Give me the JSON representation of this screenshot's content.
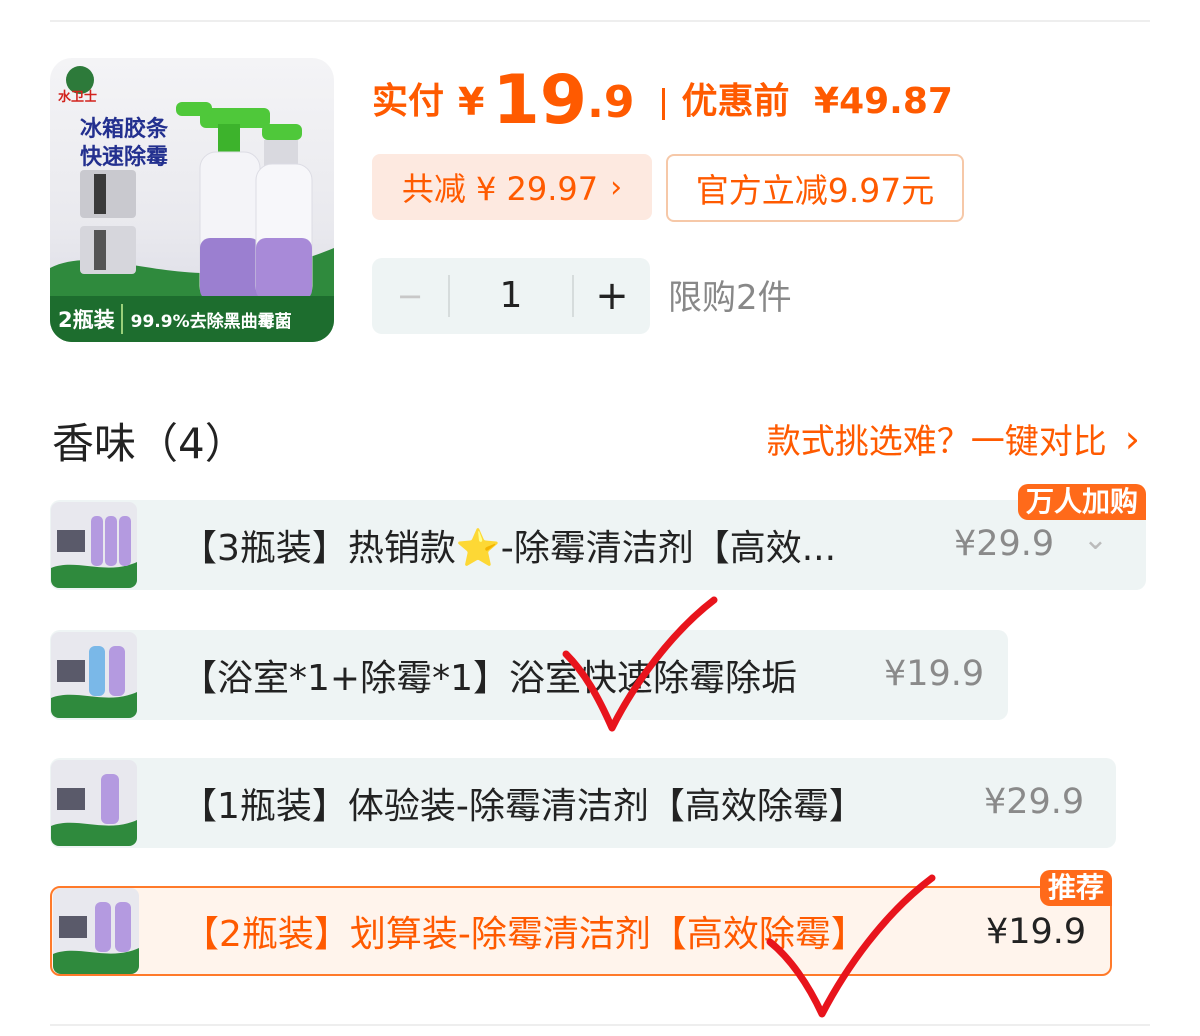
{
  "product": {
    "image_brand": "水卫士",
    "image_title_line1": "冰箱胶条",
    "image_title_line2": "快速除霉",
    "image_banner_left": "2瓶装",
    "image_banner_right": "99.9%去除黑曲霉菌"
  },
  "price": {
    "paid_label": "实付",
    "currency": "¥",
    "paid_int": "19",
    "paid_dec": ".9",
    "original_label": "优惠前",
    "original_value": "¥49.87"
  },
  "discounts": {
    "total_saved": "共减 ¥ 29.97",
    "total_saved_chevron": "›",
    "official": "官方立减9.97元"
  },
  "quantity": {
    "minus": "−",
    "value": "1",
    "plus": "+",
    "limit": "限购2件"
  },
  "variants": {
    "title": "香味（4）",
    "compare_link": "款式挑选难？一键对比",
    "compare_chevron": "›",
    "items": [
      {
        "label": "【3瓶装】热销款⭐-除霉清洁剂【高效...",
        "price": "¥29.9",
        "badge": "万人加购",
        "chevron": "⌄",
        "selected": false
      },
      {
        "label": "【浴室*1+除霉*1】浴室快速除霉除垢",
        "price": "¥19.9",
        "badge": "",
        "selected": false
      },
      {
        "label": "【1瓶装】体验装-除霉清洁剂【高效除霉】",
        "price": "¥29.9",
        "badge": "",
        "selected": false
      },
      {
        "label": "【2瓶装】划算装-除霉清洁剂【高效除霉】",
        "price": "¥19.9",
        "badge": "推荐",
        "selected": true
      }
    ]
  },
  "colors": {
    "accent": "#ff5a00",
    "option_bg": "#eef4f4",
    "selected_bg": "#fff4ec",
    "annotation_red": "#e8141c"
  },
  "annotations": [
    "checkmark-annotation",
    "checkmark-annotation"
  ]
}
